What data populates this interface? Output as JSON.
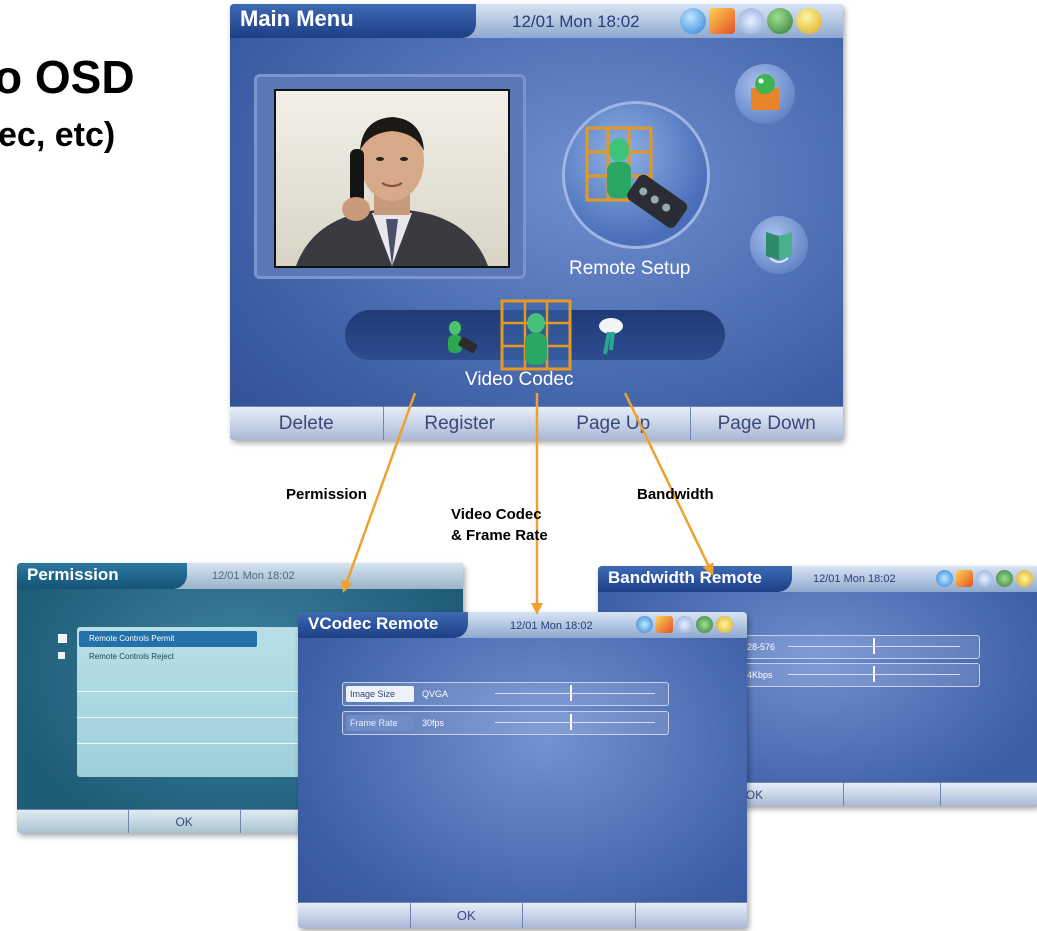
{
  "slide": {
    "title_line1": "o OSD",
    "title_line2": "ec, etc)"
  },
  "main_menu": {
    "title": "Main Menu",
    "clock": "12/01 Mon 18:02",
    "focus_label": "Remote Setup",
    "carousel_label": "Video Codec",
    "softkeys": [
      "Delete",
      "Register",
      "Page Up",
      "Page Down"
    ]
  },
  "arrows": {
    "permission": "Permission",
    "video_line1": "Video Codec",
    "video_line2": "& Frame Rate",
    "bandwidth": "Bandwidth"
  },
  "permission_screen": {
    "title": "Permission",
    "clock": "12/01 Mon 18:02",
    "options": [
      "Remote Controls Permit",
      "Remote Controls Reject"
    ],
    "ok": "OK"
  },
  "vcodec_screen": {
    "title": "VCodec Remote",
    "clock": "12/01 Mon 18:02",
    "rows": [
      {
        "label": "Image Size",
        "value": "QVGA"
      },
      {
        "label": "Frame Rate",
        "value": "30fps"
      }
    ],
    "ok": "OK"
  },
  "bandwidth_screen": {
    "title": "Bandwidth Remote",
    "clock": "12/01 Mon 18:02",
    "rows": [
      {
        "value": "28-576"
      },
      {
        "value": "4Kbps"
      }
    ],
    "ok": "OK"
  },
  "colors": {
    "screen_blue": "#3d5fa6",
    "arrow_orange": "#f0a030",
    "title_tab": "#1d3f86"
  },
  "icons": [
    "help-icon",
    "mail-icon",
    "network-icon",
    "globe-icon",
    "phone-icon"
  ]
}
